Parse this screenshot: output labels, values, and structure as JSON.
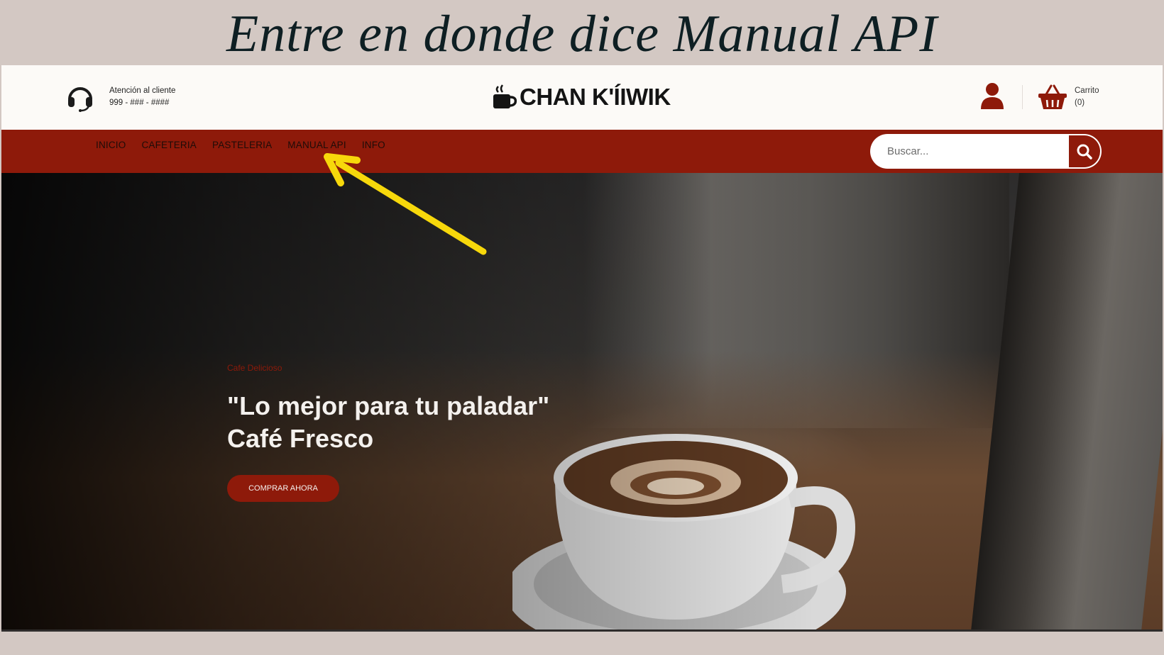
{
  "slide": {
    "title": "Entre en donde dice Manual API"
  },
  "header": {
    "support_label": "Atención al cliente",
    "support_phone": "999 - ### - ####",
    "brand_name": "CHAN K'ÍIWIK",
    "cart_label": "Carrito",
    "cart_count": "(0)"
  },
  "nav": {
    "items": [
      {
        "label": "INICIO"
      },
      {
        "label": "CAFETERIA"
      },
      {
        "label": "PASTELERIA"
      },
      {
        "label": "MANUAL API"
      },
      {
        "label": "INFO"
      }
    ],
    "search_placeholder": "Buscar..."
  },
  "hero": {
    "tag": "Cafe Delicioso",
    "headline_line1": "\"Lo mejor para tu paladar\"",
    "headline_line2": "Café Fresco",
    "cta_label": "COMPRAR AHORA"
  },
  "icons": {
    "support": "headset-icon",
    "brand": "coffee-cup-icon",
    "user": "user-icon",
    "cart": "basket-icon",
    "search": "search-icon",
    "annotation": "yellow-arrow-icon"
  },
  "colors": {
    "accent": "#8e1a0a",
    "arrow": "#f7d80b",
    "slide_bg": "#d3c8c3"
  }
}
